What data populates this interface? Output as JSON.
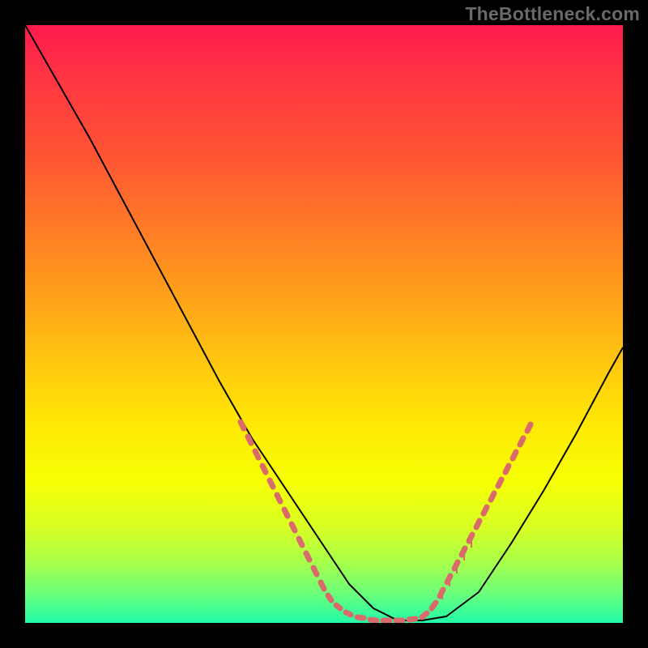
{
  "watermark": "TheBottleneck.com",
  "chart_data": {
    "type": "line",
    "title": "",
    "xlabel": "",
    "ylabel": "",
    "xlim": [
      0,
      738
    ],
    "ylim": [
      0,
      738
    ],
    "grid": false,
    "series": [
      {
        "name": "curve",
        "color": "#000000",
        "x": [
          0,
          40,
          80,
          120,
          160,
          200,
          240,
          280,
          310,
          340,
          360,
          380,
          400,
          430,
          460,
          490,
          520,
          560,
          600,
          640,
          680,
          720,
          738
        ],
        "y_top": [
          0,
          70,
          140,
          215,
          290,
          365,
          440,
          510,
          555,
          600,
          630,
          660,
          690,
          720,
          735,
          735,
          730,
          700,
          640,
          575,
          505,
          430,
          398
        ]
      }
    ],
    "dash_region": {
      "color": "#d96b6b",
      "linewidth": 7,
      "segments_left": [
        {
          "x1": 266,
          "y1": 490,
          "x2": 270,
          "y2": 498
        },
        {
          "x1": 275,
          "y1": 508,
          "x2": 279,
          "y2": 516
        },
        {
          "x1": 284,
          "y1": 526,
          "x2": 288,
          "y2": 534
        },
        {
          "x1": 293,
          "y1": 544,
          "x2": 297,
          "y2": 552
        },
        {
          "x1": 302,
          "y1": 562,
          "x2": 306,
          "y2": 570
        },
        {
          "x1": 311,
          "y1": 580,
          "x2": 315,
          "y2": 588
        },
        {
          "x1": 320,
          "y1": 598,
          "x2": 324,
          "y2": 606
        },
        {
          "x1": 329,
          "y1": 616,
          "x2": 333,
          "y2": 624
        },
        {
          "x1": 338,
          "y1": 634,
          "x2": 342,
          "y2": 642
        },
        {
          "x1": 347,
          "y1": 652,
          "x2": 351,
          "y2": 660
        },
        {
          "x1": 356,
          "y1": 670,
          "x2": 360,
          "y2": 678
        },
        {
          "x1": 365,
          "y1": 688,
          "x2": 369,
          "y2": 696
        },
        {
          "x1": 374,
          "y1": 704,
          "x2": 378,
          "y2": 710
        },
        {
          "x1": 384,
          "y1": 716,
          "x2": 389,
          "y2": 720
        },
        {
          "x1": 396,
          "y1": 725,
          "x2": 402,
          "y2": 728
        }
      ],
      "segments_bottom": [
        {
          "x1": 410,
          "y1": 731,
          "x2": 418,
          "y2": 732
        },
        {
          "x1": 426,
          "y1": 734,
          "x2": 434,
          "y2": 735
        },
        {
          "x1": 442,
          "y1": 735,
          "x2": 450,
          "y2": 735
        },
        {
          "x1": 458,
          "y1": 735,
          "x2": 466,
          "y2": 735
        },
        {
          "x1": 474,
          "y1": 734,
          "x2": 482,
          "y2": 733
        }
      ],
      "segments_right": [
        {
          "x1": 490,
          "y1": 731,
          "x2": 496,
          "y2": 726
        },
        {
          "x1": 502,
          "y1": 720,
          "x2": 507,
          "y2": 713
        },
        {
          "x1": 512,
          "y1": 705,
          "x2": 516,
          "y2": 697
        },
        {
          "x1": 521,
          "y1": 688,
          "x2": 525,
          "y2": 680
        },
        {
          "x1": 530,
          "y1": 671,
          "x2": 534,
          "y2": 663
        },
        {
          "x1": 539,
          "y1": 654,
          "x2": 543,
          "y2": 646
        },
        {
          "x1": 548,
          "y1": 637,
          "x2": 552,
          "y2": 629
        },
        {
          "x1": 557,
          "y1": 620,
          "x2": 561,
          "y2": 612
        },
        {
          "x1": 566,
          "y1": 603,
          "x2": 570,
          "y2": 595
        },
        {
          "x1": 575,
          "y1": 586,
          "x2": 579,
          "y2": 578
        },
        {
          "x1": 584,
          "y1": 569,
          "x2": 588,
          "y2": 561
        },
        {
          "x1": 593,
          "y1": 552,
          "x2": 597,
          "y2": 544
        },
        {
          "x1": 602,
          "y1": 535,
          "x2": 606,
          "y2": 527
        },
        {
          "x1": 611,
          "y1": 518,
          "x2": 615,
          "y2": 510
        },
        {
          "x1": 620,
          "y1": 501,
          "x2": 624,
          "y2": 493
        }
      ],
      "ticks_right": [
        {
          "x": 515,
          "y1": 697,
          "y2": 709
        },
        {
          "x": 524,
          "y1": 681,
          "y2": 693
        },
        {
          "x": 533,
          "y1": 665,
          "y2": 677
        },
        {
          "x": 542,
          "y1": 649,
          "y2": 661
        },
        {
          "x": 551,
          "y1": 633,
          "y2": 645
        }
      ]
    }
  }
}
